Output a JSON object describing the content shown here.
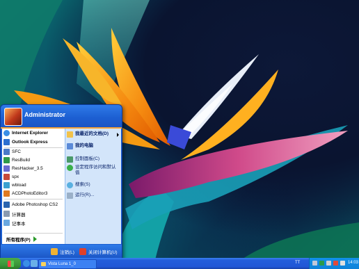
{
  "colors": {
    "menu_blue": "#1b5fd1",
    "accent_orange": "#f5a33a",
    "taskbar_blue": "#245edb",
    "start_green": "#3c973a"
  },
  "startmenu": {
    "user": "Administrator",
    "pinned": [
      {
        "label": "Internet Explorer",
        "icon": "internet-explorer-icon"
      },
      {
        "label": "Outlook Express",
        "icon": "outlook-express-icon"
      }
    ],
    "programs": [
      {
        "label": "SFC",
        "icon": "sfc-icon"
      },
      {
        "label": "ResBuild",
        "icon": "resbuild-icon"
      },
      {
        "label": "ResHacker_3.5",
        "icon": "reshacker-icon"
      },
      {
        "label": "spx",
        "icon": "spx-icon"
      },
      {
        "label": "wbload",
        "icon": "wbload-icon"
      },
      {
        "label": "ACDPhotoEditor3",
        "icon": "acd-photo-editor-icon"
      },
      {
        "label": "Adobe Photoshop CS2",
        "icon": "photoshop-icon"
      },
      {
        "label": "计算器",
        "icon": "calculator-icon"
      },
      {
        "label": "记事本",
        "icon": "notepad-icon"
      }
    ],
    "all_programs": "所有程序(P)",
    "right": [
      {
        "label": "我最近的文档(D)",
        "icon": "recent-documents-icon"
      },
      {
        "label": "我的电脑",
        "icon": "my-computer-icon"
      },
      {
        "label": "控制面板(C)",
        "icon": "control-panel-icon"
      },
      {
        "label": "设定程序访问和默认值",
        "icon": "program-access-icon"
      },
      {
        "label": "搜索(S)",
        "icon": "search-icon"
      },
      {
        "label": "运行(R)...",
        "icon": "run-icon"
      }
    ],
    "logoff": "注销(L)",
    "shutdown": "关闭计算机(U)"
  },
  "taskbar": {
    "task_label": "Vista Luna 1_0",
    "language": "TT",
    "clock": "14:03"
  }
}
